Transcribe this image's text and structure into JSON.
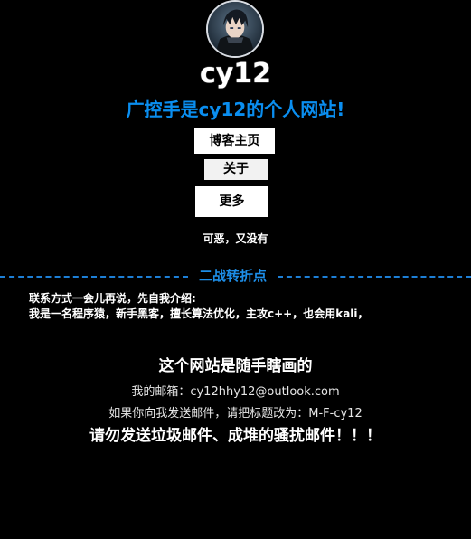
{
  "header": {
    "site_name": "cy12",
    "tagline": "广控手是cy12的个人网站!"
  },
  "nav": {
    "items": [
      {
        "label": "博客主页"
      },
      {
        "label": "关于"
      },
      {
        "label": "更多"
      }
    ]
  },
  "notice": "可恶，又没有",
  "section": {
    "title": "二战转折点",
    "accent_color": "#1d8ee8"
  },
  "intro": {
    "line1": "联系方式一会儿再说，先自我介绍:",
    "line2": "我是一名程序猿，新手黑客，擅长算法优化，主攻c++，也会用kali，"
  },
  "footer": {
    "title": "这个网站是随手瞎画的",
    "email_label": "我的邮箱：",
    "email": "cy12hhy12@outlook.com",
    "subject_note": "如果你向我发送邮件，请把标题改为：M-F-cy12",
    "warning": "请勿发送垃圾邮件、成堆的骚扰邮件！！！"
  }
}
